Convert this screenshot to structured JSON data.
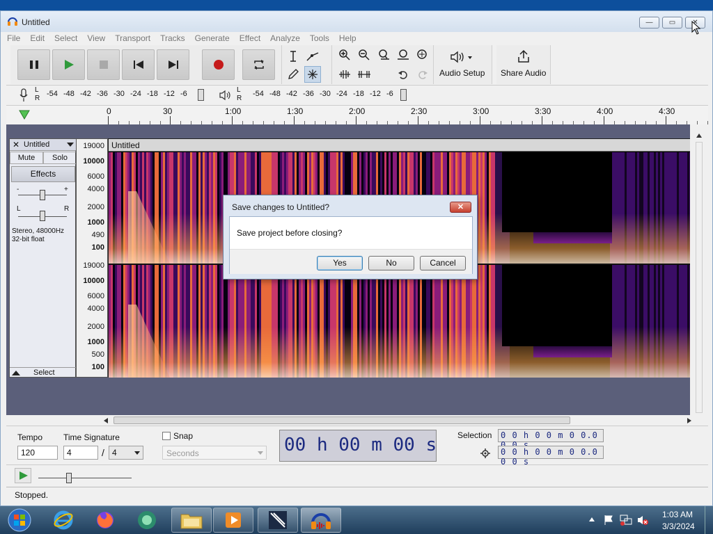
{
  "window": {
    "title": "Untitled"
  },
  "menu": [
    "File",
    "Edit",
    "Select",
    "View",
    "Transport",
    "Tracks",
    "Generate",
    "Effect",
    "Analyze",
    "Tools",
    "Help"
  ],
  "toolbar": {
    "audio_setup": "Audio Setup",
    "share_audio": "Share Audio"
  },
  "meters": {
    "rec_ticks": [
      "-54",
      "-48",
      "-42",
      "-36",
      "-30",
      "-24",
      "-18",
      "-12",
      "-6"
    ],
    "play_ticks": [
      "-54",
      "-48",
      "-42",
      "-36",
      "-30",
      "-24",
      "-18",
      "-12",
      "-6"
    ],
    "lr": [
      "L",
      "R"
    ]
  },
  "ruler": {
    "ticks": [
      "0",
      "30",
      "1:00",
      "1:30",
      "2:00",
      "2:30",
      "3:00",
      "3:30",
      "4:00",
      "4:30"
    ]
  },
  "track": {
    "name": "Untitled",
    "clip_name": "Untitled",
    "mute": "Mute",
    "solo": "Solo",
    "effects": "Effects",
    "pan_l": "L",
    "pan_r": "R",
    "gain_minus": "-",
    "gain_plus": "+",
    "info_line1": "Stereo, 48000Hz",
    "info_line2": "32-bit float",
    "select": "Select",
    "scale_top": [
      "19000",
      "10000",
      "6000",
      "4000",
      "2000",
      "1000",
      "490",
      "100"
    ],
    "scale_bottom": [
      "19000",
      "10000",
      "6000",
      "4000",
      "2000",
      "1000",
      "500",
      "100"
    ]
  },
  "bottom": {
    "tempo_label": "Tempo",
    "tempo_value": "120",
    "timesig_label": "Time Signature",
    "timesig_num": "4",
    "timesig_slash": "/",
    "timesig_den": "4",
    "snap_label": "Snap",
    "snap_unit": "Seconds",
    "time_display": "00 h 00 m 00 s",
    "selection_label": "Selection",
    "sel_start": "0 0 h 0 0 m 0 0.0 0 0 s",
    "sel_end": "0 0 h 0 0 m 0 0.0 0 0 s"
  },
  "status": {
    "text": "Stopped."
  },
  "dialog": {
    "title": "Save changes to Untitled?",
    "message": "Save project before closing?",
    "yes": "Yes",
    "no": "No",
    "cancel": "Cancel",
    "close": "✕"
  },
  "taskbar": {
    "time": "1:03 AM",
    "date": "3/3/2024"
  }
}
